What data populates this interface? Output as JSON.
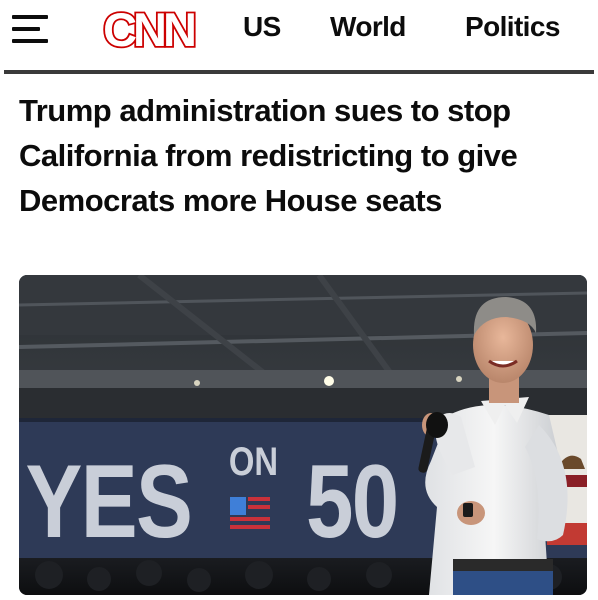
{
  "header": {
    "logo_text": "CNN",
    "nav": [
      {
        "label": "US"
      },
      {
        "label": "World"
      },
      {
        "label": "Politics"
      }
    ]
  },
  "article": {
    "headline": "Trump administration sues to stop California from redistricting to give Democrats more House seats"
  },
  "hero_image": {
    "banner_word": "YES",
    "banner_on": "ON",
    "banner_number": "50"
  },
  "colors": {
    "brand_red": "#cc0000",
    "text": "#0c0c0c",
    "divider": "#3a3a3a",
    "banner_bg": "#2e3a57",
    "banner_text": "#c9ced8"
  }
}
